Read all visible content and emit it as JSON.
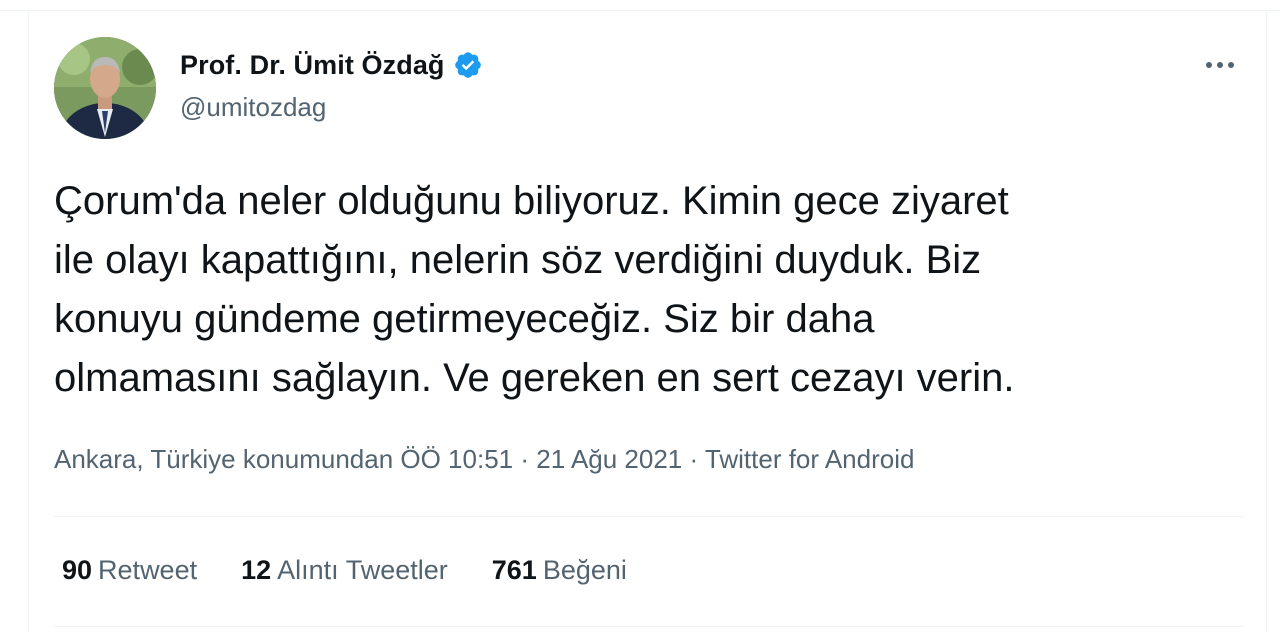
{
  "author": {
    "display_name": "Prof. Dr. Ümit Özdağ",
    "handle": "@umitozdag",
    "verified": true
  },
  "tweet": {
    "text": "Çorum'da neler olduğunu biliyoruz. Kimin gece ziyaret\nile olayı kapattığını, nelerin söz verdiğini duyduk. Biz\nkonuyu gündeme getirmeyeceğiz. Siz bir daha\nolmamasını sağlayın. Ve gereken en sert cezayı verin."
  },
  "meta": {
    "location": "Ankara, Türkiye konumundan",
    "time": "ÖÖ 10:51",
    "date": "21 Ağu 2021",
    "separator": " · ",
    "source": "Twitter for Android"
  },
  "stats": {
    "retweets": {
      "count": "90",
      "label": "Retweet"
    },
    "quotes": {
      "count": "12",
      "label": "Alıntı Tweetler"
    },
    "likes": {
      "count": "761",
      "label": "Beğeni"
    }
  },
  "icons": {
    "verified": "verified-badge-icon",
    "more": "more-horizontal-icon"
  },
  "colors": {
    "verified_blue": "#1d9bf0",
    "secondary_text": "#536471",
    "primary_text": "#0f1419"
  }
}
